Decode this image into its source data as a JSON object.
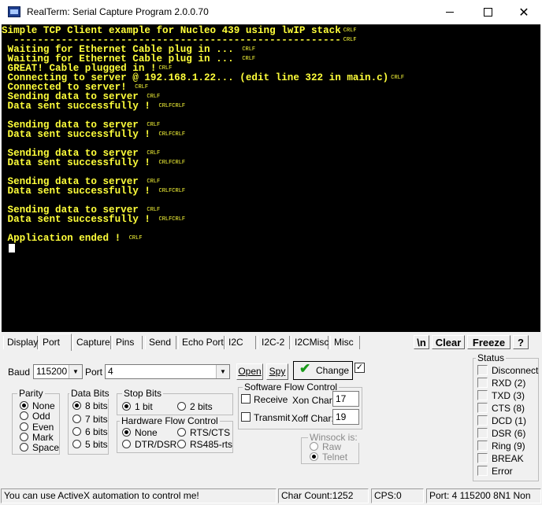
{
  "window": {
    "title": "RealTerm: Serial Capture Program 2.0.0.70",
    "minimize_glyph": "",
    "close_glyph": "✕"
  },
  "terminal": {
    "lines": [
      {
        "text": "Simple TCP Client example for Nucleo 439 using lwIP stack",
        "crlf": "CRLF"
      },
      {
        "text": "  -------------------------------------------------------",
        "crlf": "CRLF"
      },
      {
        "text": " Waiting for Ethernet Cable plug in ... ",
        "crlf": "CRLF"
      },
      {
        "text": " Waiting for Ethernet Cable plug in ... ",
        "crlf": "CRLF"
      },
      {
        "text": " GREAT! Cable plugged in !",
        "crlf": "CRLF"
      },
      {
        "text": " Connecting to server @ 192.168.1.22... (edit line 322 in main.c)",
        "crlf": "CRLF"
      },
      {
        "text": " Connected to server! ",
        "crlf": "CRLF"
      },
      {
        "text": " Sending data to server ",
        "crlf": "CRLF"
      },
      {
        "text": " Data sent successfully ! ",
        "crlf": "CRLFCRLF"
      },
      {
        "text": "",
        "crlf": ""
      },
      {
        "text": " Sending data to server ",
        "crlf": "CRLF"
      },
      {
        "text": " Data sent successfully ! ",
        "crlf": "CRLFCRLF"
      },
      {
        "text": "",
        "crlf": ""
      },
      {
        "text": " Sending data to server ",
        "crlf": "CRLF"
      },
      {
        "text": " Data sent successfully ! ",
        "crlf": "CRLFCRLF"
      },
      {
        "text": "",
        "crlf": ""
      },
      {
        "text": " Sending data to server ",
        "crlf": "CRLF"
      },
      {
        "text": " Data sent successfully ! ",
        "crlf": "CRLFCRLF"
      },
      {
        "text": "",
        "crlf": ""
      },
      {
        "text": " Sending data to server ",
        "crlf": "CRLF"
      },
      {
        "text": " Data sent successfully ! ",
        "crlf": "CRLFCRLF"
      },
      {
        "text": "",
        "crlf": ""
      },
      {
        "text": " Application ended ! ",
        "crlf": "CRLF"
      }
    ],
    "text_color": "#ffff3a",
    "background": "#000000"
  },
  "tabs": {
    "items": [
      "Display",
      "Port",
      "Capture",
      "Pins",
      "Send",
      "Echo Port",
      "I2C",
      "I2C-2",
      "I2CMisc",
      "Misc"
    ],
    "active": "Port",
    "newline_btn": "\\n",
    "clear_btn": "Clear",
    "freeze_btn": "Freeze",
    "help_btn": "?"
  },
  "port": {
    "baud_label": "Baud",
    "baud_value": "115200",
    "port_label": "Port",
    "port_value": "4",
    "open_btn": "Open",
    "spy_btn": "Spy",
    "change_btn": "Change",
    "parity": {
      "title": "Parity",
      "options": [
        "None",
        "Odd",
        "Even",
        "Mark",
        "Space"
      ],
      "selected": "None"
    },
    "databits": {
      "title": "Data Bits",
      "options": [
        "8 bits",
        "7 bits",
        "6 bits",
        "5 bits"
      ],
      "selected": "8 bits"
    },
    "stopbits": {
      "title": "Stop Bits",
      "options": [
        "1 bit",
        "2 bits"
      ],
      "selected": "1 bit"
    },
    "hwflow": {
      "title": "Hardware Flow Control",
      "options": [
        "None",
        "RTS/CTS",
        "DTR/DSR",
        "RS485-rts"
      ],
      "selected": "None"
    },
    "swflow": {
      "title": "Software Flow Control",
      "receive": "Receive",
      "transmit": "Transmit",
      "xon_label": "Xon Char:",
      "xon_value": "17",
      "xoff_label": "Xoff Char:",
      "xoff_value": "19"
    },
    "winsock": {
      "title": "Winsock is:",
      "options": [
        "Raw",
        "Telnet"
      ],
      "selected": "Telnet"
    }
  },
  "status_panel": {
    "title": "Status",
    "items": [
      "Disconnect",
      "RXD (2)",
      "TXD (3)",
      "CTS (8)",
      "DCD (1)",
      "DSR (6)",
      "Ring (9)",
      "BREAK",
      "Error"
    ]
  },
  "statusbar": {
    "message": "You can use ActiveX automation to control me!",
    "char_count": "Char Count:1252",
    "cps": "CPS:0",
    "port_info": "Port: 4 115200 8N1 Non"
  },
  "colors": {
    "change_check": "#1a9a1a",
    "chrome": "#f0f0f0"
  }
}
